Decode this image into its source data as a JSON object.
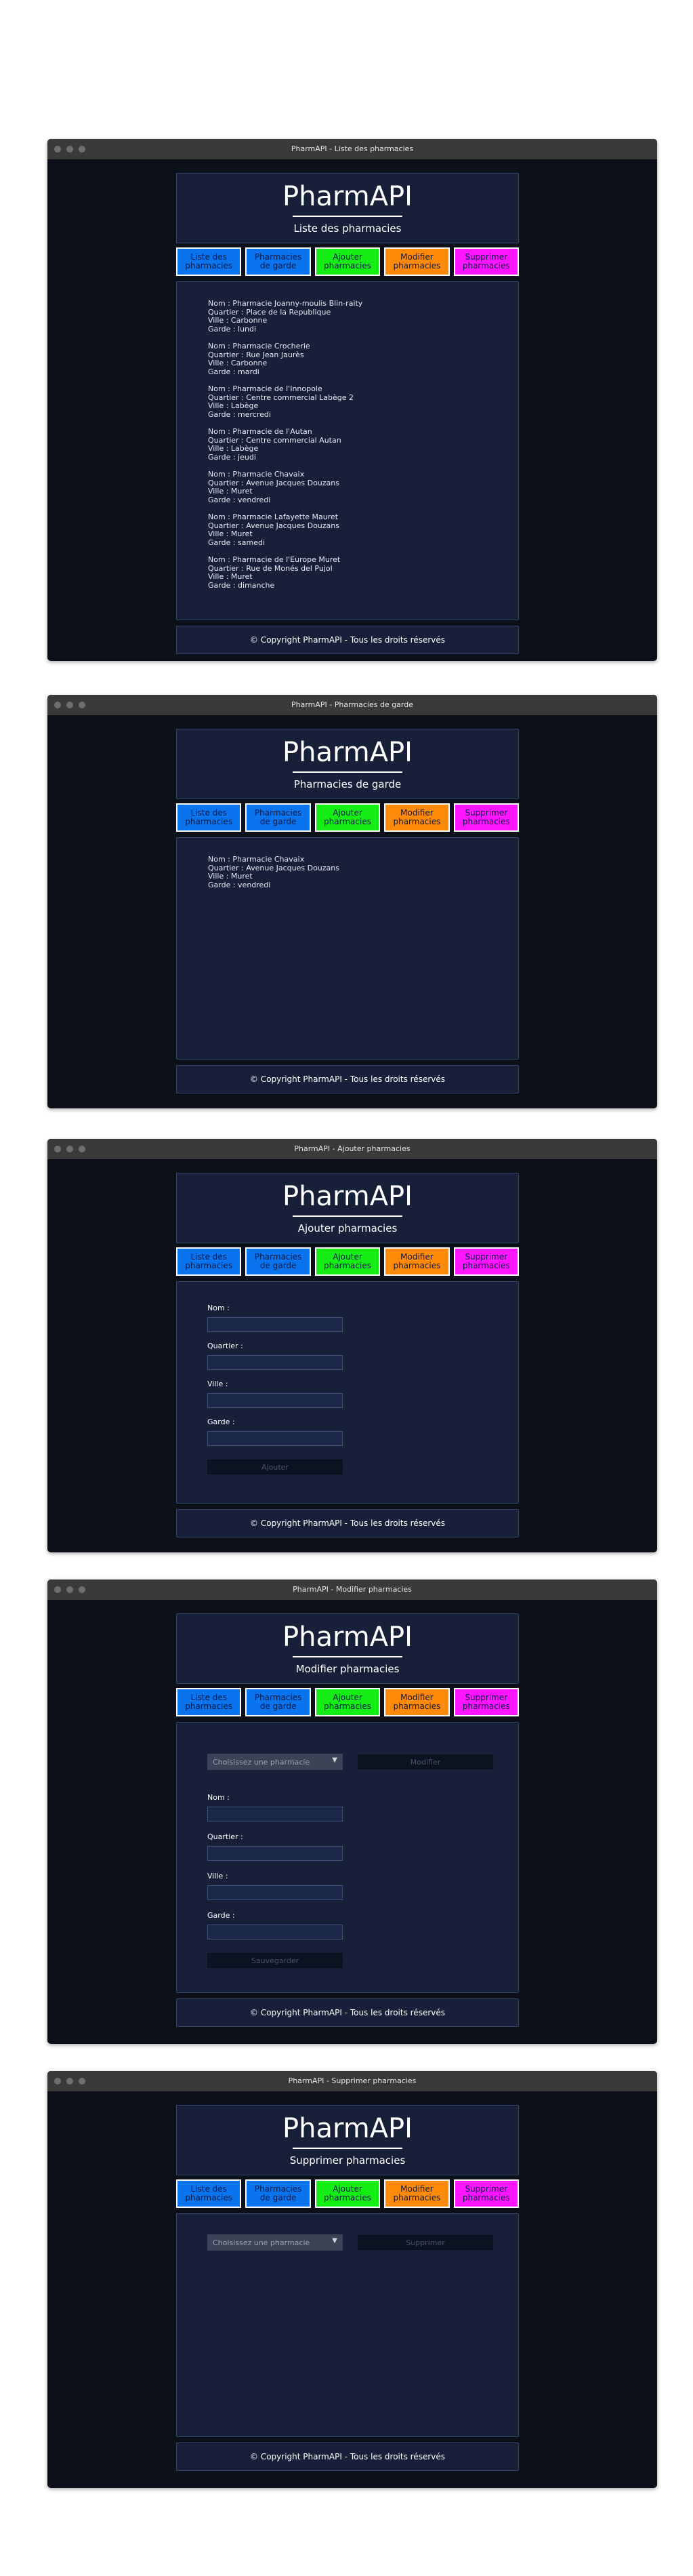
{
  "app": {
    "brand": "PharmAPI",
    "footer": "© Copyright PharmAPI - Tous les droits réservés"
  },
  "nav": [
    {
      "label": "Liste des\npharmacies"
    },
    {
      "label": "Pharmacies\nde garde"
    },
    {
      "label": "Ajouter\npharmacies"
    },
    {
      "label": "Modifier\npharmacies"
    },
    {
      "label": "Supprimer\npharmacies"
    }
  ],
  "colors": {
    "nav_blue": "#0a73ee",
    "nav_green": "#14ee14",
    "nav_orange": "#ff8a0a",
    "nav_magenta": "#ff15ff",
    "window_bg": "#0c1019",
    "panel_bg": "#172038"
  },
  "windows": [
    {
      "title": "PharmAPI - Liste des pharmacies",
      "heading": "Liste des pharmacies"
    },
    {
      "title": "PharmAPI - Pharmacies de garde",
      "heading": "Pharmacies de garde"
    },
    {
      "title": "PharmAPI - Ajouter pharmacies",
      "heading": "Ajouter pharmacies"
    },
    {
      "title": "PharmAPI - Modifier pharmacies",
      "heading": "Modifier pharmacies"
    },
    {
      "title": "PharmAPI - Supprimer pharmacies",
      "heading": "Supprimer pharmacies"
    }
  ],
  "pharmacies": [
    {
      "nom": "Nom : Pharmacie Joanny-moulis Blin-raity",
      "quartier": "Quartier : Place de la Republique",
      "ville": "Ville : Carbonne",
      "garde": "Garde : lundi"
    },
    {
      "nom": "Nom : Pharmacie Crocherie",
      "quartier": "Quartier : Rue Jean Jaurès",
      "ville": "Ville : Carbonne",
      "garde": "Garde : mardi"
    },
    {
      "nom": "Nom : Pharmacie de l'Innopole",
      "quartier": "Quartier : Centre commercial Labège 2",
      "ville": "Ville : Labège",
      "garde": "Garde : mercredi"
    },
    {
      "nom": "Nom : Pharmacie de l'Autan",
      "quartier": "Quartier : Centre commercial Autan",
      "ville": "Ville : Labège",
      "garde": "Garde : jeudi"
    },
    {
      "nom": "Nom : Pharmacie Chavaix",
      "quartier": "Quartier : Avenue Jacques Douzans",
      "ville": "Ville : Muret",
      "garde": "Garde : vendredi"
    },
    {
      "nom": "Nom : Pharmacie Lafayette Mauret",
      "quartier": "Quartier : Avenue Jacques Douzans",
      "ville": "Ville : Muret",
      "garde": "Garde : samedi"
    },
    {
      "nom": "Nom : Pharmacie de l'Europe Muret",
      "quartier": "Quartier : Rue de Monés del Pujol",
      "ville": "Ville : Muret",
      "garde": "Garde : dimanche"
    }
  ],
  "garde": {
    "nom": "Nom : Pharmacie Chavaix",
    "quartier": "Quartier : Avenue Jacques Douzans",
    "ville": "Ville : Muret",
    "garde": "Garde : vendredi"
  },
  "form": {
    "nom_label": "Nom :",
    "quartier_label": "Quartier :",
    "ville_label": "Ville :",
    "garde_label": "Garde :",
    "ajouter_button": "Ajouter",
    "modifier_button": "Modifier",
    "save_button": "Sauvegarder",
    "supprimer_button": "Supprimer",
    "select_placeholder": "Choisissez une pharmacie"
  }
}
